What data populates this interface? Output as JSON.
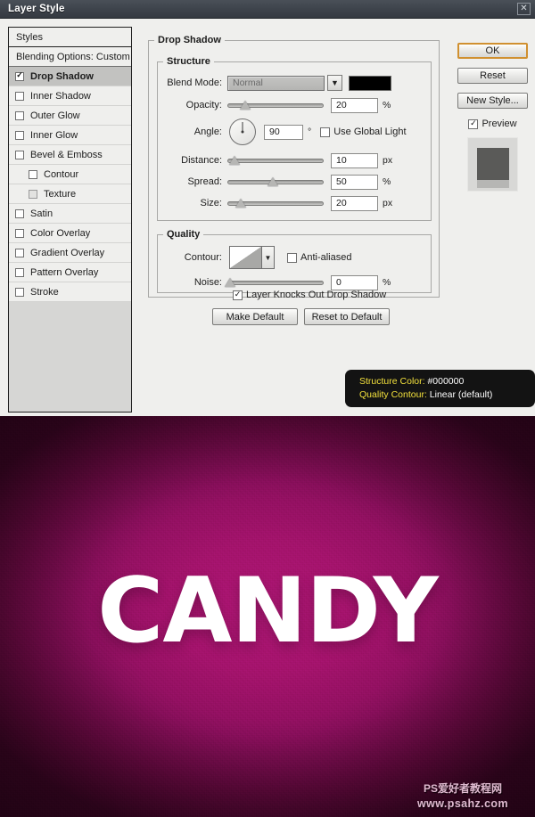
{
  "window": {
    "title": "Layer Style",
    "close_icon": "close-icon",
    "close_label": "✕"
  },
  "styles_panel": {
    "header": "Styles",
    "blending_options": "Blending Options: Custom",
    "items": [
      {
        "label": "Drop Shadow",
        "checked": true,
        "selected": true,
        "sub": false,
        "disabled": false
      },
      {
        "label": "Inner Shadow",
        "checked": false,
        "selected": false,
        "sub": false,
        "disabled": false
      },
      {
        "label": "Outer Glow",
        "checked": false,
        "selected": false,
        "sub": false,
        "disabled": false
      },
      {
        "label": "Inner Glow",
        "checked": false,
        "selected": false,
        "sub": false,
        "disabled": false
      },
      {
        "label": "Bevel & Emboss",
        "checked": false,
        "selected": false,
        "sub": false,
        "disabled": false
      },
      {
        "label": "Contour",
        "checked": false,
        "selected": false,
        "sub": true,
        "disabled": false
      },
      {
        "label": "Texture",
        "checked": false,
        "selected": false,
        "sub": true,
        "disabled": true
      },
      {
        "label": "Satin",
        "checked": false,
        "selected": false,
        "sub": false,
        "disabled": false
      },
      {
        "label": "Color Overlay",
        "checked": false,
        "selected": false,
        "sub": false,
        "disabled": false
      },
      {
        "label": "Gradient Overlay",
        "checked": false,
        "selected": false,
        "sub": false,
        "disabled": false
      },
      {
        "label": "Pattern Overlay",
        "checked": false,
        "selected": false,
        "sub": false,
        "disabled": false
      },
      {
        "label": "Stroke",
        "checked": false,
        "selected": false,
        "sub": false,
        "disabled": false
      }
    ]
  },
  "drop_shadow": {
    "group_title": "Drop Shadow",
    "structure": {
      "title": "Structure",
      "blend_mode_label": "Blend Mode:",
      "blend_mode_value": "Normal",
      "blend_mode_arrow": "▼",
      "shadow_color": "#000000",
      "opacity_label": "Opacity:",
      "opacity_value": "20",
      "opacity_unit": "%",
      "angle_label": "Angle:",
      "angle_value": "90",
      "angle_unit": "°",
      "use_global_light": "Use Global Light",
      "use_global_light_checked": false,
      "distance_label": "Distance:",
      "distance_value": "10",
      "distance_unit": "px",
      "spread_label": "Spread:",
      "spread_value": "50",
      "spread_unit": "%",
      "size_label": "Size:",
      "size_value": "20",
      "size_unit": "px"
    },
    "quality": {
      "title": "Quality",
      "contour_label": "Contour:",
      "contour_value": "Linear (default)",
      "contour_arrow": "▼",
      "anti_aliased": "Anti-aliased",
      "anti_aliased_checked": false,
      "noise_label": "Noise:",
      "noise_value": "0",
      "noise_unit": "%"
    },
    "knocks_out": "Layer Knocks Out Drop Shadow",
    "knocks_out_checked": true,
    "make_default": "Make Default",
    "reset_to_default": "Reset to Default"
  },
  "right_buttons": {
    "ok": "OK",
    "reset": "Reset",
    "new_style": "New Style...",
    "preview": "Preview",
    "preview_checked": true
  },
  "tooltip": {
    "line1_key": "Structure Color:",
    "line1_value": "#000000",
    "line2_key": "Quality Contour:",
    "line2_value": "Linear (default)"
  },
  "artwork": {
    "text": "CANDY",
    "text_color": "#ffffff",
    "background_center": "#ad1674",
    "background_edge": "#3d0525"
  },
  "watermark": {
    "line1": "PS爱好者教程网",
    "line2": "www.psahz.com"
  }
}
